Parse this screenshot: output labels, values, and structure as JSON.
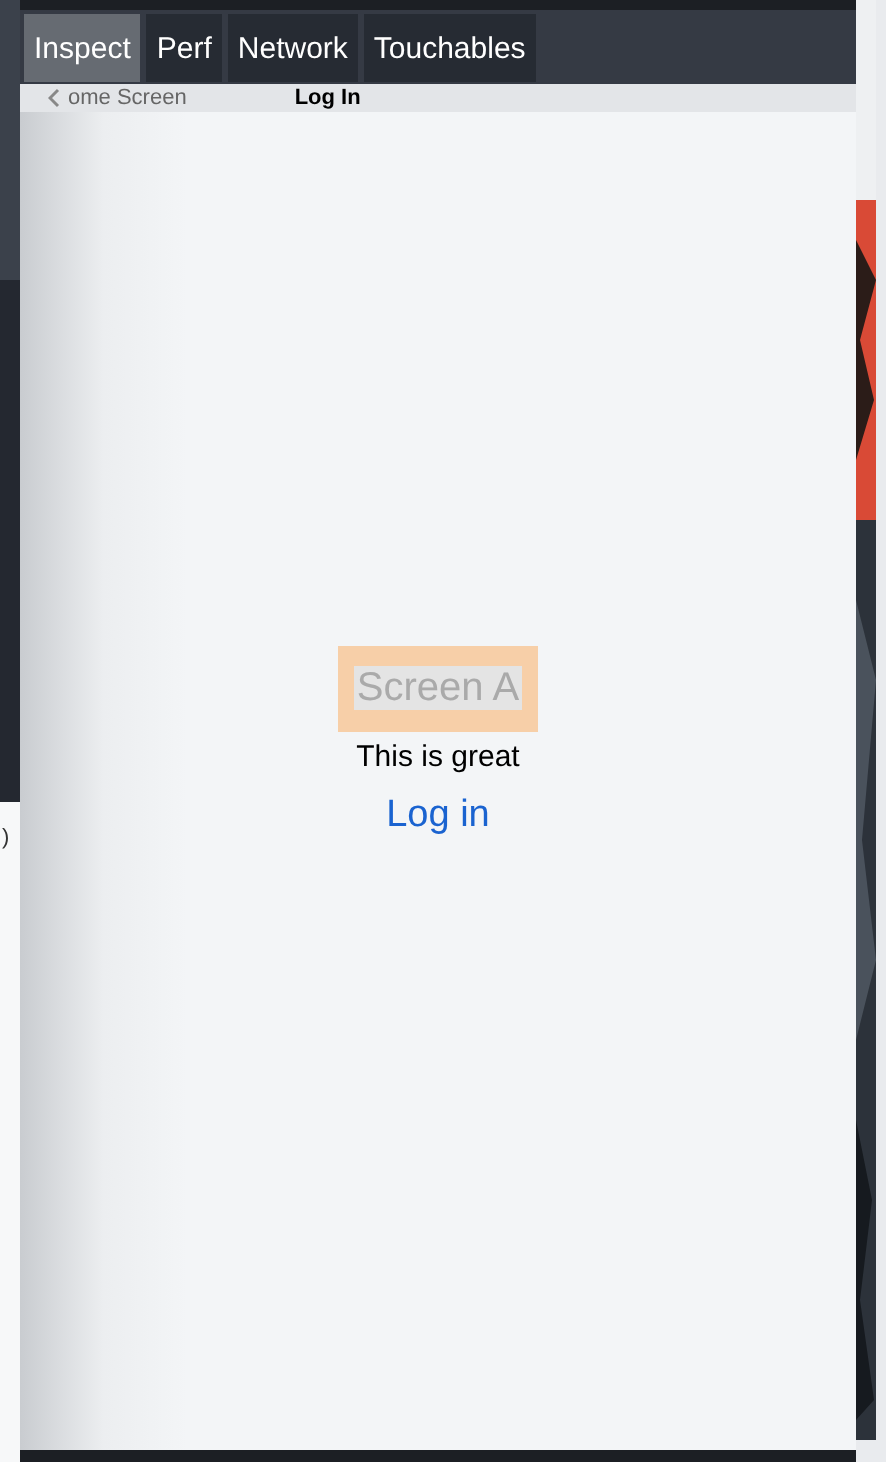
{
  "background_window": {
    "text": ")"
  },
  "inspector_tabs": [
    {
      "label": "Inspect",
      "selected": true
    },
    {
      "label": "Perf",
      "selected": false
    },
    {
      "label": "Network",
      "selected": false
    },
    {
      "label": "Touchables",
      "selected": false
    }
  ],
  "nav_bar": {
    "back_label": "ome Screen",
    "title": "Log In"
  },
  "screen": {
    "title": "Screen A",
    "title_highlighted": true,
    "subtitle": "This is great",
    "link": "Log in"
  }
}
